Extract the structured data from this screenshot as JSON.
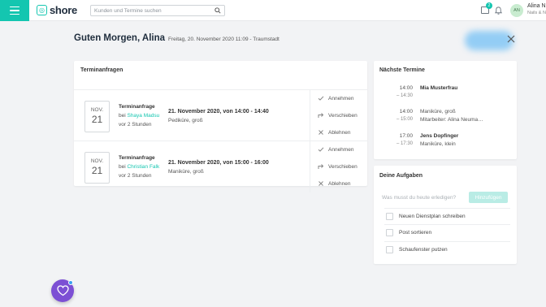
{
  "app": {
    "logo_text": "shore",
    "accent": "#14c6b0"
  },
  "header": {
    "search_placeholder": "Kunden und Termine suchen",
    "notification_count": "2",
    "user": {
      "initials": "AN",
      "name": "Alina N",
      "subtitle": "Nails & N"
    }
  },
  "greeting": {
    "title": "Guten Morgen, Alina",
    "date": "Freitag, 20. November 2020 11:09 - Traumstadt"
  },
  "requests": {
    "title": "Terminanfragen",
    "items": [
      {
        "month": "NOV.",
        "day": "21",
        "label": "Terminanfrage",
        "by_prefix": "bei ",
        "by": "Shaya Madsu",
        "ago": "vor 2 Stunden",
        "when": "21. November 2020, von 14:00 - 14:40",
        "service": "Pediküre, groß",
        "accept": "Annehmen",
        "move": "Verschieben",
        "decline": "Ablehnen"
      },
      {
        "month": "NOV.",
        "day": "21",
        "label": "Terminanfrage",
        "by_prefix": "bei ",
        "by": "Christian Falk",
        "ago": "vor 2 Stunden",
        "when": "21. November 2020, von 15:00 - 16:00",
        "service": "Maniküre, groß",
        "accept": "Annehmen",
        "move": "Verschieben",
        "decline": "Ablehnen"
      }
    ]
  },
  "next": {
    "title": "Nächste Termine",
    "items": [
      {
        "start": "14:00",
        "end": "– 14:30",
        "line1": "Mia Musterfrau",
        "line2": ""
      },
      {
        "start": "14:00",
        "end": "– 15:00",
        "line1": "Maniküre, groß",
        "line2": "Mitarbeiter: Alina Neuma…"
      },
      {
        "start": "17:00",
        "end": "– 17:30",
        "line1": "Jens Dopfinger",
        "line2": "Maniküre, klein"
      }
    ]
  },
  "tasks": {
    "title": "Deine Aufgaben",
    "placeholder": "Was musst du heute erledigen?",
    "add_label": "Hinzufügen",
    "items": [
      "Neuen Dienstplan schreiben",
      "Post sortieren",
      "Schaufenster putzen"
    ]
  }
}
